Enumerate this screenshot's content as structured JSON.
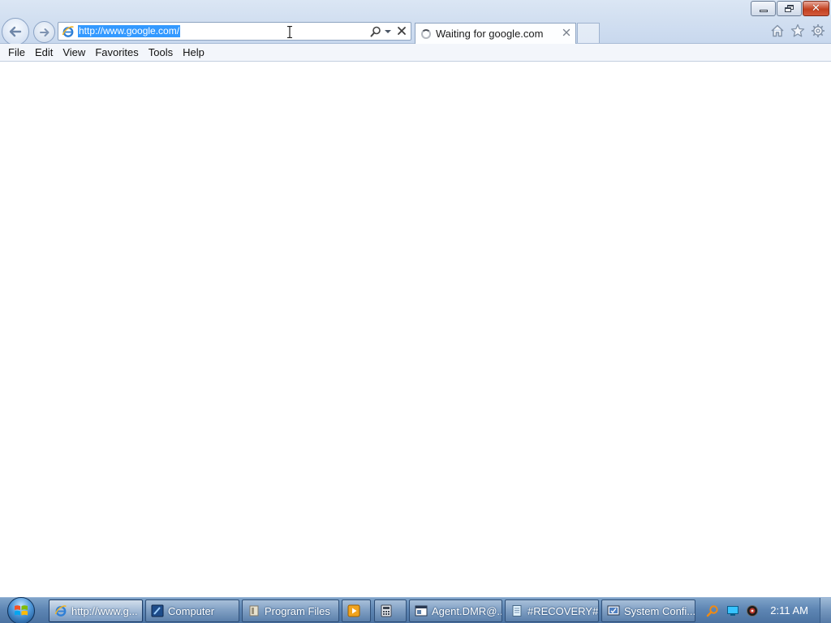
{
  "browser": {
    "address": {
      "url": "http://www.google.com/"
    },
    "tab": {
      "title": "Waiting for google.com"
    },
    "menu": [
      "File",
      "Edit",
      "View",
      "Favorites",
      "Tools",
      "Help"
    ],
    "icons": {
      "back": "back-arrow-icon",
      "forward": "forward-arrow-icon",
      "favicon": "internet-explorer-icon",
      "search": "search-icon",
      "stop": "stop-icon",
      "home": "home-icon",
      "favorites": "star-icon",
      "tools": "gear-icon"
    }
  },
  "taskbar": {
    "buttons": [
      {
        "label": "http://www.g...",
        "icon": "internet-explorer-icon",
        "active": true
      },
      {
        "label": "Computer",
        "icon": "computer-icon"
      },
      {
        "label": "Program Files",
        "icon": "folder-icon"
      },
      {
        "label": "",
        "icon": "media-player-icon"
      },
      {
        "label": "",
        "icon": "calculator-icon"
      },
      {
        "label": "Agent.DMR@...",
        "icon": "window-icon"
      },
      {
        "label": "#RECOVERY#...",
        "icon": "notepad-icon"
      },
      {
        "label": "System Confi...",
        "icon": "system-config-icon"
      }
    ],
    "tray_icons": [
      "search-tray-icon",
      "network-icon",
      "volume-icon"
    ],
    "clock": "2:11 AM"
  },
  "colors": {
    "selection": "#3399ff",
    "chrome": "#d3e0f1",
    "taskbar": "#5e86b4",
    "close_button": "#c2401f"
  }
}
